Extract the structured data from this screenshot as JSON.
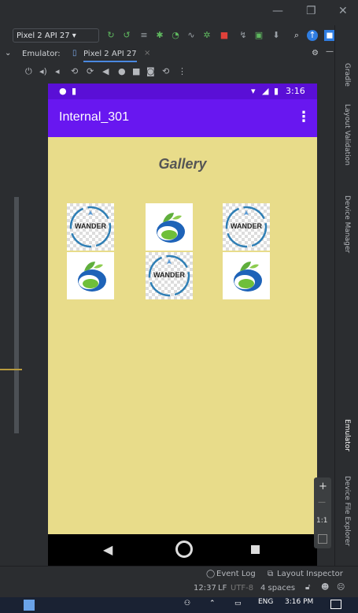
{
  "window": {
    "minimize": "—",
    "maximize": "❐",
    "close": "✕"
  },
  "toolbar": {
    "device_selector": "Pixel 2 API 27 ▾"
  },
  "tabs": {
    "emulator_label": "Emulator:",
    "device_tab": "Pixel 2 API 27",
    "close": "×"
  },
  "emulator_controls": [
    "power",
    "volume-up",
    "volume-down",
    "rotate-left",
    "rotate-right",
    "back",
    "home",
    "overview",
    "screenshot",
    "snapshot",
    "more"
  ],
  "phone": {
    "status_time": "3:16",
    "app_title": "Internal_301",
    "overflow": "⋮",
    "gallery_title": "Gallery",
    "images": [
      {
        "kind": "wander",
        "label": "WANDER"
      },
      {
        "kind": "leaf"
      },
      {
        "kind": "wander",
        "label": "WANDER"
      },
      {
        "kind": "leaf"
      },
      {
        "kind": "wander",
        "label": "WANDER"
      },
      {
        "kind": "leaf"
      }
    ]
  },
  "right_panel": {
    "gradle": "Gradle",
    "layout_validation": "Layout Validation",
    "device_manager": "Device Manager",
    "emulator": "Emulator",
    "device_file_explorer": "Device File Explorer"
  },
  "side_controls": {
    "zoom_in": "+",
    "zoom_out": "—",
    "ratio": "1:1"
  },
  "bottom": {
    "event_log": "Event Log",
    "layout_inspector": "Layout Inspector",
    "position": "12:37",
    "line_sep": "LF",
    "encoding": "UTF-8",
    "indent": "4 spaces"
  },
  "taskbar": {
    "lang": "ENG",
    "time": "3:16 PM"
  }
}
